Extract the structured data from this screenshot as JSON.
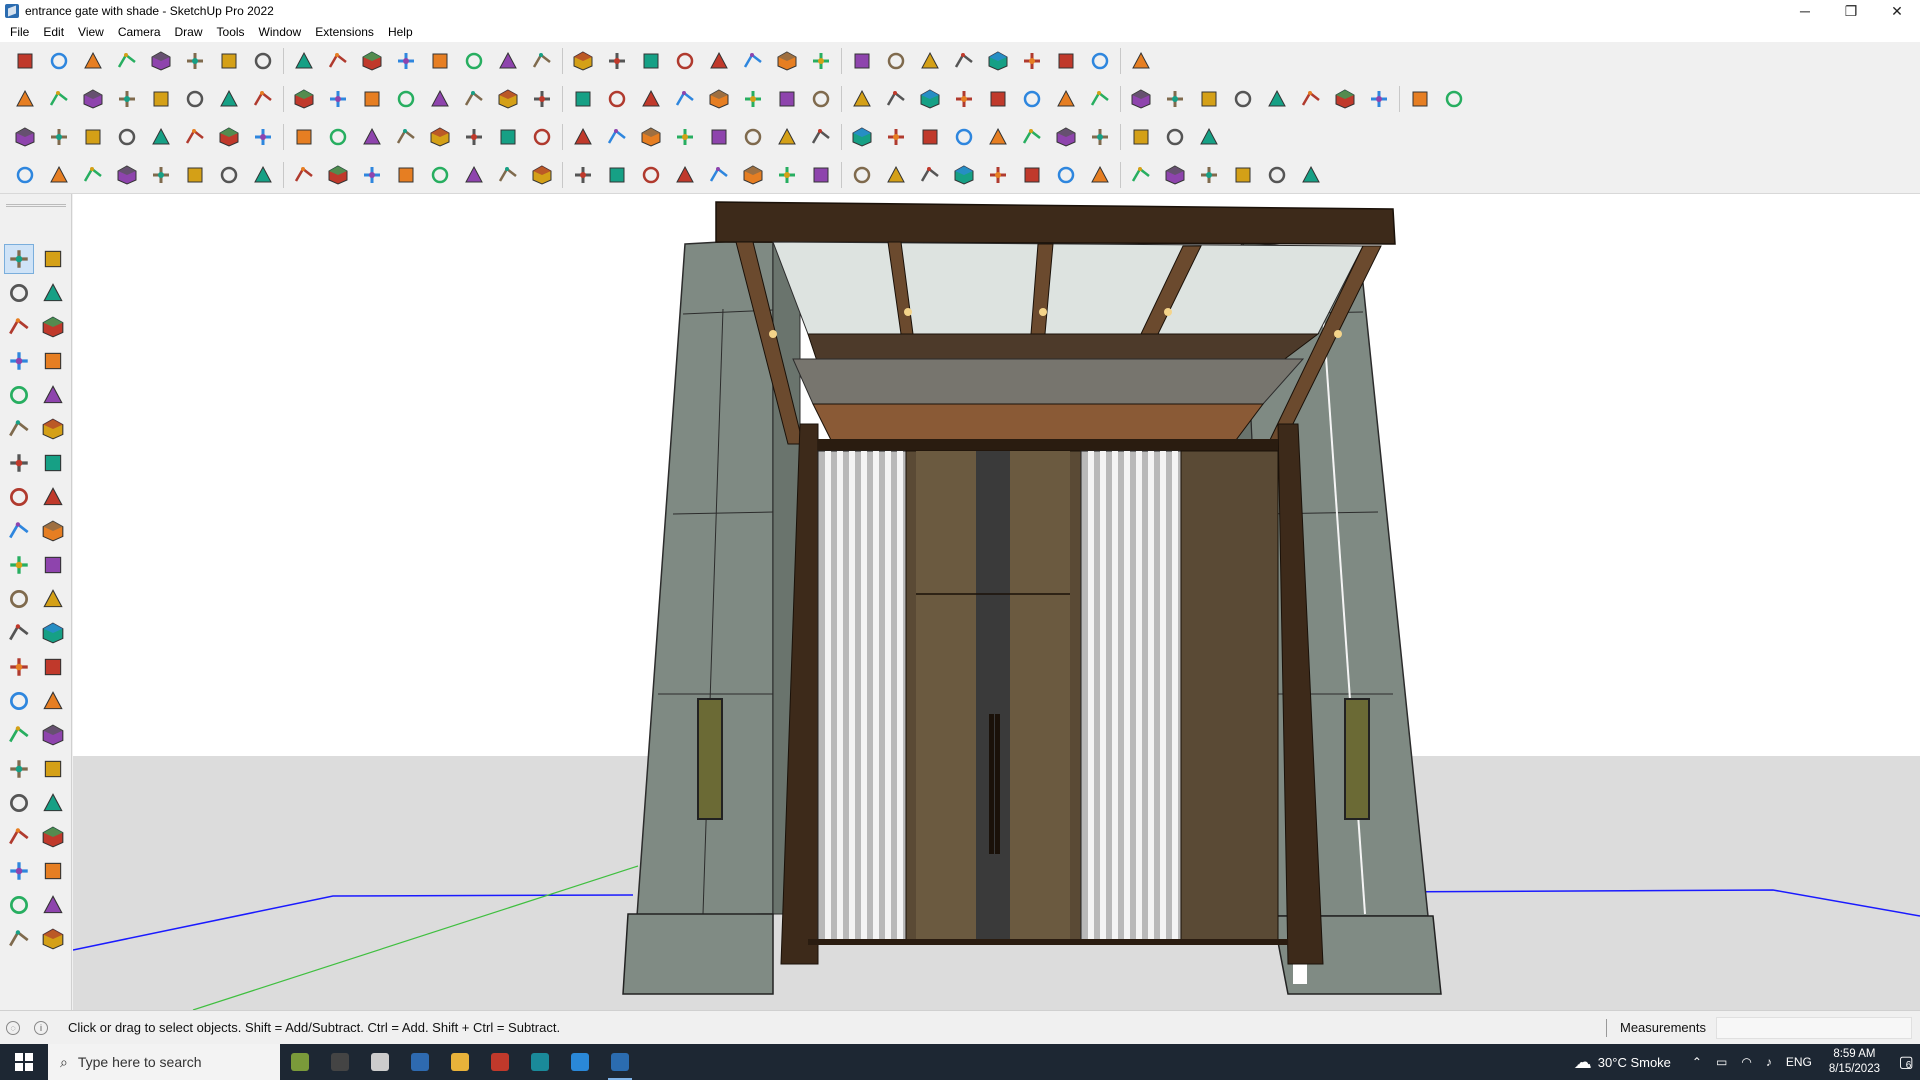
{
  "window": {
    "title": "entrance gate with shade - SketchUp Pro 2022",
    "controls": {
      "minimize": "─",
      "restore": "❐",
      "close": "✕"
    }
  },
  "menu": {
    "items": [
      "File",
      "Edit",
      "View",
      "Camera",
      "Draw",
      "Tools",
      "Window",
      "Extensions",
      "Help"
    ]
  },
  "toolbar": {
    "row1_icons": [
      "zoom-icon",
      "select-icon",
      "eraser-icon",
      "line-icon",
      "arc-icon",
      "rectangle-icon",
      "push-pull-icon",
      "follow-me-icon",
      "move-icon",
      "rotate-icon",
      "scale-icon",
      "tape-measure-icon",
      "text-icon",
      "paint-bucket-icon",
      "orbit-icon",
      "pan-icon",
      "zoom-tool-icon",
      "zoom-extents-icon",
      "section-plane-icon",
      "display-section-planes-icon",
      "display-section-cuts-icon",
      "section-fill-icon",
      "styles-icon",
      "components-icon",
      "materials-icon",
      "layers-icon",
      "sort-up-icon",
      "sort-down-icon",
      "dimension-icon",
      "protractor-icon",
      "undo-icon",
      "redo-icon",
      "help-icon"
    ],
    "row2_icons": [
      "iso-view-icon",
      "top-view-icon",
      "front-view-icon",
      "union-icon",
      "x-axis-icon",
      "y-axis-icon",
      "red-axis-icon",
      "green-axis-icon",
      "blue-axis-icon",
      "orange-axis-icon",
      "magenta-axis-icon",
      "hide-icon",
      "xray-icon",
      "backedges-icon",
      "wireframe-icon",
      "hiddenline-icon",
      "shaded-icon",
      "textured-icon",
      "monochrome-icon",
      "house-icon",
      "door-icon",
      "window-icon",
      "roof-icon",
      "sandbox-icon",
      "leaf-icon",
      "ruler-icon",
      "circle-icon",
      "ellipse-icon",
      "polygon-icon",
      "curve-icon",
      "spiral-icon",
      "spline-icon",
      "bezier-icon",
      "offset-icon",
      "fillet-icon",
      "chamfer-icon",
      "loft-icon",
      "extrude-icon",
      "shell-icon",
      "stamp-icon",
      "drape-icon",
      "grid-icon"
    ],
    "row3_icons": [
      "shape-blue-icon",
      "plane-icon",
      "face-icon",
      "text-label-icon",
      "curve-arrow-icon",
      "red-square-icon",
      "list-icon",
      "page-icon",
      "wood-icon",
      "chain-icon",
      "corner-icon",
      "dots-icon",
      "plus-red-icon",
      "plus-green-icon",
      "x-blue-icon",
      "cone-icon",
      "fire-icon",
      "triangle-icon",
      "lasso-icon",
      "paint-icon",
      "swirl-icon",
      "move-cross-icon",
      "box-icon",
      "magnet-icon",
      "tree-icon",
      "gear-icon",
      "cube-icon",
      "star-icon",
      "robot-icon",
      "frame-icon",
      "grid-orange-icon",
      "grid-yellow-icon",
      "cross-red-icon",
      "arc-dots-icon",
      "tile-icon"
    ],
    "row4_icons": [
      "sketch-icon",
      "curve-tool-icon",
      "red-car-icon",
      "ellipse-sketch-icon",
      "lens-icon",
      "pipe-icon",
      "cube-sketch-icon",
      "cog-sketch-icon",
      "bend-icon",
      "corner-l-icon",
      "corner-r-icon",
      "line-red-icon",
      "line-orange-icon",
      "frame-sketch-icon",
      "pyramid-icon",
      "columns-icon",
      "fence-icon",
      "hand-icon",
      "leaf-sketch-icon",
      "arrow-icon",
      "stack-icon",
      "stair-icon",
      "scissors-icon",
      "brush-icon",
      "rake-icon",
      "dome-icon",
      "ramp-icon",
      "loft-sketch-icon",
      "arch-icon",
      "weave-icon",
      "mesh-icon",
      "panel-icon",
      "comb-icon",
      "gear-sketch-icon",
      "gear-sketch-2-icon",
      "fan-icon",
      "wave-icon",
      "lattice-icon"
    ]
  },
  "palette": {
    "tools": [
      "select-tool-icon",
      "orbit-tool-icon",
      "paint-tool-icon",
      "eraser-tool-icon",
      "components-tool-icon",
      "tag-tool-icon",
      "line-tool-icon",
      "freehand-tool-icon",
      "rectangle-tool-icon",
      "rotated-rect-tool-icon",
      "circle-tool-icon",
      "polygon-tool-icon",
      "arc-tool-icon",
      "arc-2pt-tool-icon",
      "arc-3pt-tool-icon",
      "pie-tool-icon",
      "move-tool-icon",
      "pushpull-tool-icon",
      "rotate-tool-icon",
      "followme-tool-icon",
      "scale-tool-icon",
      "offset-tool-icon",
      "tape-tool-icon",
      "dimension-tool-icon",
      "protractor-tool-icon",
      "text-tool-icon",
      "axes-tool-icon",
      "3dtext-tool-icon",
      "orbit-view-icon",
      "pan-view-icon",
      "zoom-view-icon",
      "zoom-window-icon",
      "zoom-extents-view-icon",
      "previous-view-icon",
      "position-camera-icon",
      "look-around-icon",
      "walk-icon",
      "section-tool-icon",
      "section-display-icon",
      "section-cut-icon",
      "section-fill-tool-icon",
      "xray-tool-icon"
    ]
  },
  "colors": {
    "blue_axis": "#1a1aff",
    "green_axis": "#3fbf3f",
    "sky": "#ffffff",
    "ground": "#dcdcdc",
    "stone": "#7f8a83",
    "wood_dark": "#3d2a1a",
    "wood_light": "#8a5a36",
    "taskbar": "#1d2733"
  },
  "status": {
    "hint": "Click or drag to select objects. Shift = Add/Subtract. Ctrl = Add. Shift + Ctrl = Subtract.",
    "measurements_label": "Measurements",
    "measurements_value": ""
  },
  "taskbar": {
    "search_placeholder": "Type here to search",
    "apps": [
      "minecraft-icon",
      "headset-icon",
      "task-view-icon",
      "calculator-icon",
      "file-explorer-icon",
      "acrobat-icon",
      "3dsmax-icon",
      "edge-icon",
      "sketchup-icon"
    ],
    "weather": "30°C  Smoke",
    "language": "ENG",
    "time": "8:59 AM",
    "date": "8/15/2023",
    "notifications": "6"
  }
}
